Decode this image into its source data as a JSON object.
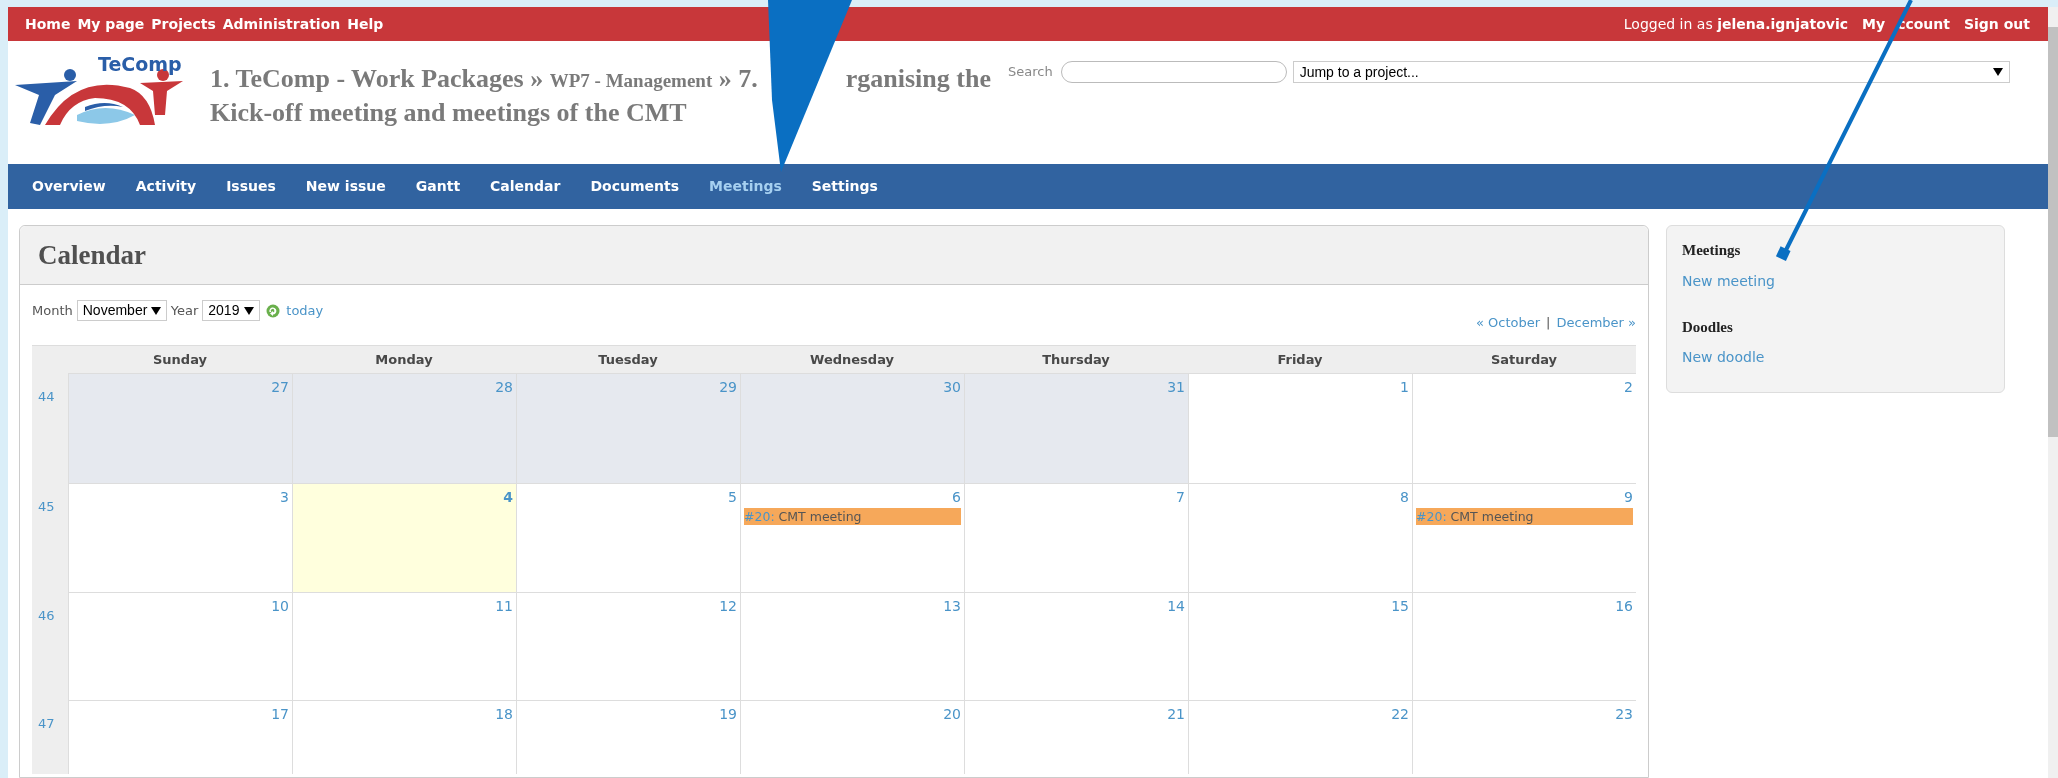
{
  "top_menu": {
    "items": [
      "Home",
      "My page",
      "Projects",
      "Administration",
      "Help"
    ],
    "logged_in_label": "Logged in as",
    "username": "jelena.ignjatovic",
    "account_link": {
      "visible_start": "My",
      "visible_end": "ccount"
    },
    "sign_out": "Sign out"
  },
  "header": {
    "logo_text": "TeComp",
    "project_title": {
      "parent": "1. TeComp - Work Packages",
      "separators": [
        "»",
        "»"
      ],
      "sub": "WP7 - Management",
      "visible_start": "7.",
      "visible_end": "rganising the Kick-off meeting and meetings of the CMT"
    },
    "search_label": "Search",
    "jump_select": "Jump to a project..."
  },
  "tabs": [
    {
      "label": "Overview",
      "selected": false
    },
    {
      "label": "Activity",
      "selected": false
    },
    {
      "label": "Issues",
      "selected": false
    },
    {
      "label": "New issue",
      "selected": false
    },
    {
      "label": "Gantt",
      "selected": false
    },
    {
      "label": "Calendar",
      "selected": false
    },
    {
      "label": "Documents",
      "selected": false
    },
    {
      "label": "Meetings",
      "selected": true
    },
    {
      "label": "Settings",
      "selected": false
    }
  ],
  "calendar": {
    "title": "Calendar",
    "month_label": "Month",
    "month": "November",
    "year_label": "Year",
    "year": "2019",
    "today_link": "today",
    "prev_link": "« October",
    "pager_separator": "|",
    "next_link": "December »",
    "day_names": [
      "Sunday",
      "Monday",
      "Tuesday",
      "Wednesday",
      "Thursday",
      "Friday",
      "Saturday"
    ],
    "weeks": [
      {
        "number": "44",
        "days": [
          {
            "day": "27",
            "other_month": true,
            "today": false
          },
          {
            "day": "28",
            "other_month": true,
            "today": false
          },
          {
            "day": "29",
            "other_month": true,
            "today": false
          },
          {
            "day": "30",
            "other_month": true,
            "today": false
          },
          {
            "day": "31",
            "other_month": true,
            "today": false
          },
          {
            "day": "1",
            "other_month": false,
            "today": false
          },
          {
            "day": "2",
            "other_month": false,
            "today": false
          }
        ]
      },
      {
        "number": "45",
        "days": [
          {
            "day": "3",
            "other_month": false,
            "today": false
          },
          {
            "day": "4",
            "other_month": false,
            "today": true
          },
          {
            "day": "5",
            "other_month": false,
            "today": false
          },
          {
            "day": "6",
            "other_month": false,
            "today": false,
            "events": [
              {
                "id": "#20:",
                "title": "CMT meeting"
              }
            ]
          },
          {
            "day": "7",
            "other_month": false,
            "today": false
          },
          {
            "day": "8",
            "other_month": false,
            "today": false
          },
          {
            "day": "9",
            "other_month": false,
            "today": false,
            "events": [
              {
                "id": "#20:",
                "title": "CMT meeting"
              }
            ]
          }
        ]
      },
      {
        "number": "46",
        "days": [
          {
            "day": "10",
            "other_month": false,
            "today": false
          },
          {
            "day": "11",
            "other_month": false,
            "today": false
          },
          {
            "day": "12",
            "other_month": false,
            "today": false
          },
          {
            "day": "13",
            "other_month": false,
            "today": false
          },
          {
            "day": "14",
            "other_month": false,
            "today": false
          },
          {
            "day": "15",
            "other_month": false,
            "today": false
          },
          {
            "day": "16",
            "other_month": false,
            "today": false
          }
        ]
      },
      {
        "number": "47",
        "days": [
          {
            "day": "17",
            "other_month": false,
            "today": false
          },
          {
            "day": "18",
            "other_month": false,
            "today": false
          },
          {
            "day": "19",
            "other_month": false,
            "today": false
          },
          {
            "day": "20",
            "other_month": false,
            "today": false
          },
          {
            "day": "21",
            "other_month": false,
            "today": false
          },
          {
            "day": "22",
            "other_month": false,
            "today": false
          },
          {
            "day": "23",
            "other_month": false,
            "today": false
          }
        ]
      }
    ]
  },
  "sidebar": {
    "sections": [
      {
        "heading": "Meetings",
        "link": "New meeting"
      },
      {
        "heading": "Doodles",
        "link": "New doodle"
      }
    ]
  }
}
